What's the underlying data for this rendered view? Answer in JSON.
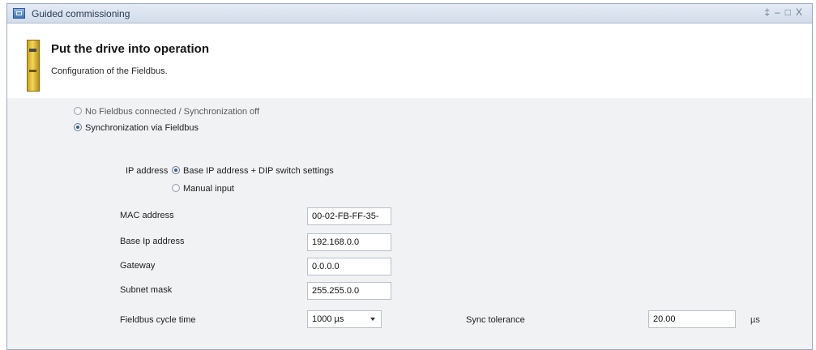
{
  "window": {
    "title": "Guided commissioning",
    "controls": [
      "‡",
      "–",
      "□",
      "X"
    ]
  },
  "header": {
    "title": "Put the drive into operation",
    "subtitle": "Configuration of the Fieldbus."
  },
  "sync_options": [
    {
      "label": "No Fieldbus connected / Synchronization off",
      "selected": false
    },
    {
      "label": "Synchronization via Fieldbus",
      "selected": true
    }
  ],
  "ip": {
    "label": "IP address",
    "options": [
      {
        "label": "Base IP address + DIP switch settings",
        "selected": true
      },
      {
        "label": "Manual input",
        "selected": false
      }
    ]
  },
  "fields": {
    "mac": {
      "label": "MAC address",
      "value": "00-02-FB-FF-35-"
    },
    "base_ip": {
      "label": "Base Ip address",
      "value": "192.168.0.0"
    },
    "gateway": {
      "label": "Gateway",
      "value": "0.0.0.0"
    },
    "subnet": {
      "label": "Subnet mask",
      "value": "255.255.0.0"
    },
    "cycle_time": {
      "label": "Fieldbus cycle time",
      "value": "1000 µs"
    },
    "sync_tolerance": {
      "label": "Sync tolerance",
      "value": "20.00",
      "unit": "µs"
    }
  }
}
